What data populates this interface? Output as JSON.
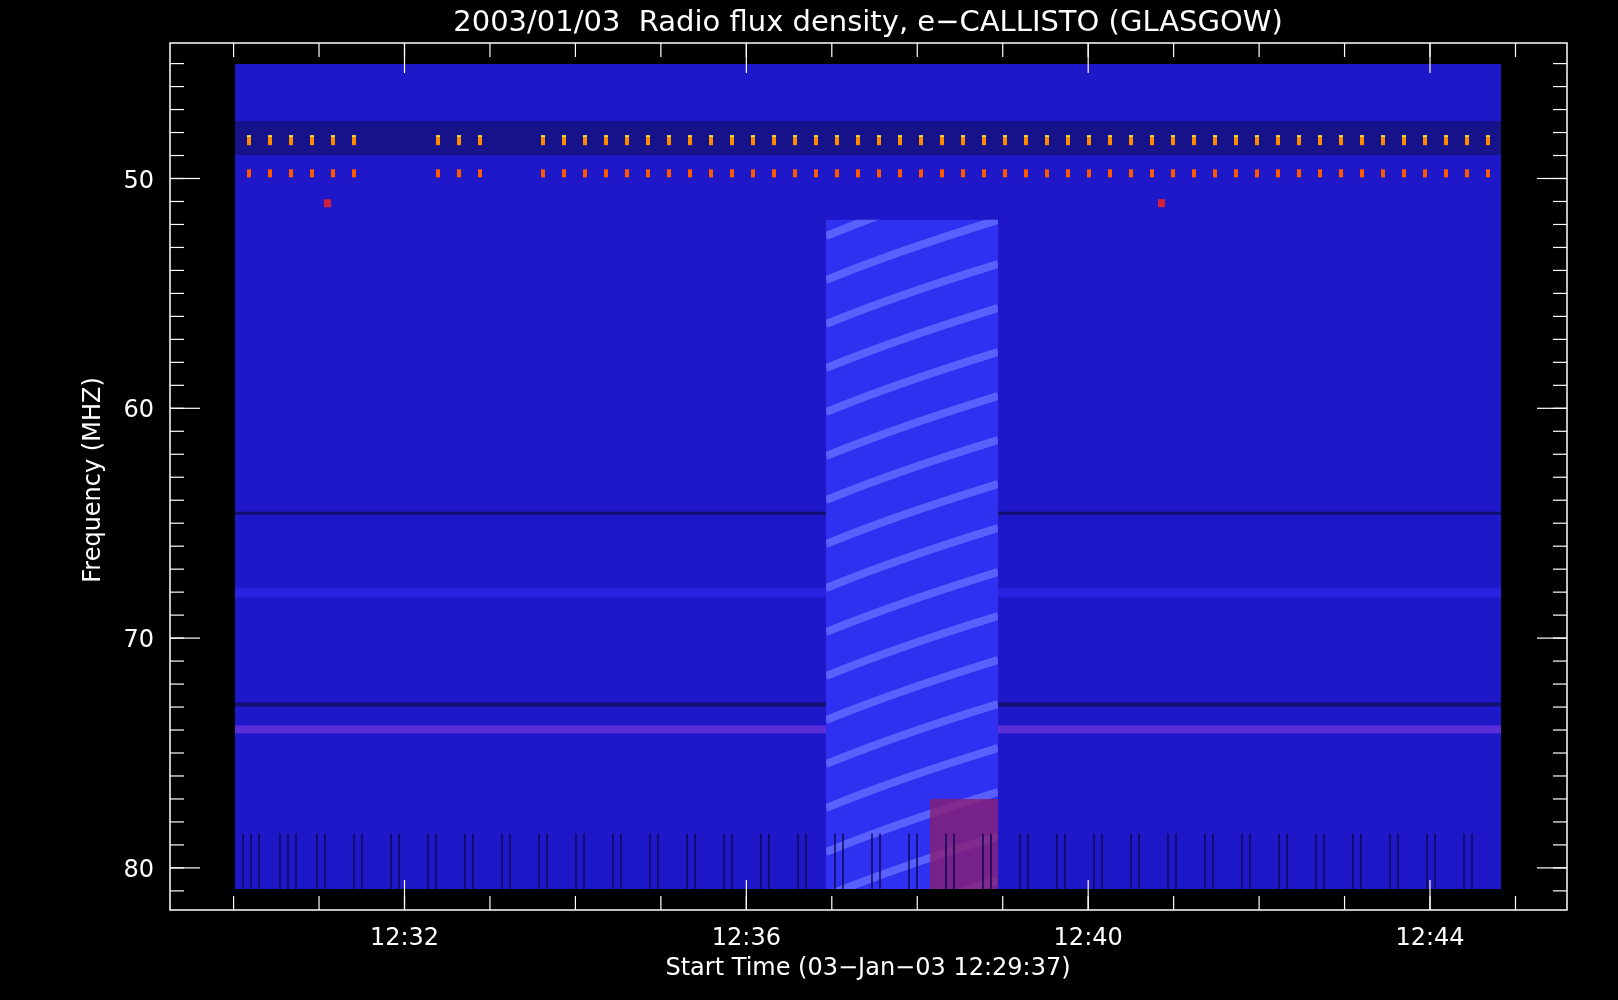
{
  "title": "2003/01/03  Radio flux density, e−CALLISTO (GLASGOW)",
  "y_axis": {
    "label": "Frequency (MHZ)",
    "tick_labels": [
      "50",
      "60",
      "70",
      "80"
    ]
  },
  "x_axis": {
    "label": "Start Time (03−Jan−03 12:29:37)",
    "tick_labels": [
      "12:32",
      "12:36",
      "12:40",
      "12:44"
    ]
  }
}
